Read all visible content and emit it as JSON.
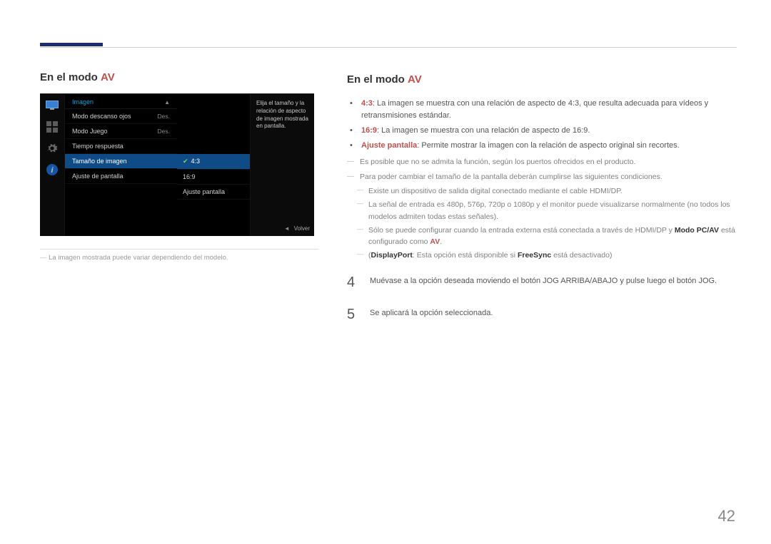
{
  "accent": "#1d2e6e",
  "highlight_color": "#c0504d",
  "left": {
    "title_prefix": "En el modo ",
    "title_highlight": "AV",
    "caption": "La imagen mostrada puede variar dependiendo del modelo."
  },
  "osd": {
    "menu_title": "Imagen",
    "items": [
      {
        "label": "Modo descanso ojos",
        "value": "Des."
      },
      {
        "label": "Modo Juego",
        "value": "Des."
      },
      {
        "label": "Tiempo respuesta",
        "value": ""
      },
      {
        "label": "Tamaño de imagen",
        "value": "",
        "selected": true
      },
      {
        "label": "Ajuste de pantalla",
        "value": ""
      }
    ],
    "submenu": [
      {
        "label": "4:3",
        "selected": true
      },
      {
        "label": "16:9"
      },
      {
        "label": "Ajuste pantalla"
      }
    ],
    "info_text": "Elija el tamaño y la relación de aspecto de imagen mostrada en pantalla.",
    "footer_label": "Volver"
  },
  "right": {
    "title_prefix": "En el modo ",
    "title_highlight": "AV",
    "b1_bold": "4:3",
    "b1_rest": ": La imagen se muestra con una relación de aspecto de 4:3, que resulta adecuada para vídeos y retransmisiones estándar.",
    "b2_bold": "16:9",
    "b2_rest": ": La imagen se muestra con una relación de aspecto de 16:9.",
    "b3_bold": "Ajuste pantalla",
    "b3_rest": ": Permite mostrar la imagen con la relación de aspecto original sin recortes.",
    "dash1": "Es posible que no se admita la función, según los puertos ofrecidos en el producto.",
    "dash2": "Para poder cambiar el tamaño de la pantalla deberán cumplirse las siguientes condiciones.",
    "sub1": "Existe un dispositivo de salida digital conectado mediante el cable HDMI/DP.",
    "sub2": "La señal de entrada es 480p, 576p, 720p o 1080p y el monitor puede visualizarse normalmente (no todos los modelos admiten todas estas señales).",
    "sub3_a": "Sólo se puede configurar cuando la entrada externa está conectada a través de HDMI/DP y ",
    "sub3_bold1": "Modo PC/AV",
    "sub3_b": " está configurado como ",
    "sub3_bold2": "AV",
    "sub3_c": ".",
    "sub4_a": "(",
    "sub4_bold1": "DisplayPort",
    "sub4_b": ": Esta opción está disponible si ",
    "sub4_bold2": "FreeSync",
    "sub4_c": " está desactivado)",
    "step4_num": "4",
    "step4_text": "Muévase a la opción deseada moviendo el botón JOG ARRIBA/ABAJO y pulse luego el botón JOG.",
    "step5_num": "5",
    "step5_text": "Se aplicará la opción seleccionada."
  },
  "page_number": "42"
}
